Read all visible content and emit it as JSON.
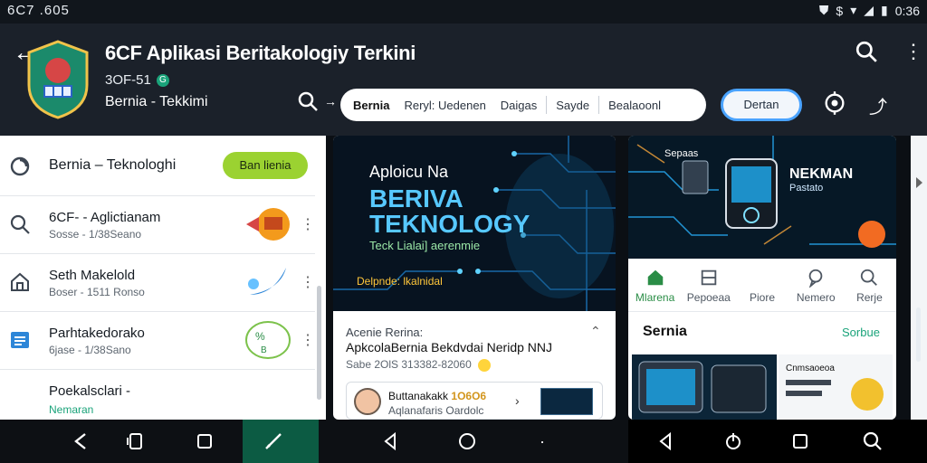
{
  "status_bar": {
    "time": "6C7 .605",
    "right_time": "0:36"
  },
  "app": {
    "title": "6CF Aplikasi Beritakologiy Terkini",
    "subline": "3OF-51",
    "subtitle": "Bernia - Tekkimi"
  },
  "tabs": [
    {
      "label": "Bernia",
      "active": true
    },
    {
      "label": "Reryl: Uedenen",
      "active": false
    },
    {
      "label": "Daigas",
      "active": false
    },
    {
      "label": "Sayde",
      "active": false
    },
    {
      "label": "Bealaoonl",
      "active": false
    }
  ],
  "follow_button": "Dertan",
  "left_list": {
    "header_title": "Bernia – Teknologhi",
    "header_button": "Ban lienia",
    "items": [
      {
        "title": "6CF- - Aglictianam",
        "meta": "Sosse - 1/38Seano"
      },
      {
        "title": "Seth Makelold",
        "meta": "Boser - 1511 Ronso"
      },
      {
        "title": "Parhtakedorako",
        "meta": "6jase - 1/38Sano"
      },
      {
        "title": "Poekalsclari -",
        "meta": "Nemaran"
      }
    ]
  },
  "mid_card": {
    "hero_line1": "Aploicu Na",
    "hero_line2": "BERIVA",
    "hero_line3": "TEKNOLOGY",
    "hero_line4": "Teck Lialai] aerenmie",
    "hero_line5": "Delpnde: lkalnidal",
    "meta1": "Acenie Rerina:",
    "meta2": "ApkcolaBernia Bekdvdai Neridp NNJ",
    "meta3": "Sabe 2OlS 313382-82060",
    "author_name": "Buttanakakk",
    "author_badge": "1O6O6",
    "author_desc": "Aqlanafaris Oardolc"
  },
  "right_card": {
    "hero_small": "Sepaas",
    "hero_title": "NEKMAN",
    "hero_sub": "Pastato",
    "nav": [
      {
        "label": "Mlarena",
        "icon": "home-icon",
        "active": true
      },
      {
        "label": "Pepoeaa",
        "icon": "square-icon",
        "active": false
      },
      {
        "label": "Piore",
        "icon": "person-icon",
        "active": false
      },
      {
        "label": "Nemero",
        "icon": "chat-icon",
        "active": false
      },
      {
        "label": "Rerje",
        "icon": "search-icon",
        "active": false
      }
    ],
    "section": "Sernia",
    "section_link": "Sorbue",
    "thumb2_title": "Cnmsaoeoa"
  },
  "colors": {
    "appbar": "#1b212a",
    "accent_green": "#9bd231",
    "link_teal": "#1aa37a",
    "hero_blue": "#57c8ff",
    "hero_yellow": "#ffc63a",
    "orange": "#f26b22"
  },
  "icons": {
    "back": "arrow-left-icon",
    "search": "search-icon",
    "more": "more-vertical-icon",
    "settings": "settings-icon",
    "share": "share-icon"
  }
}
